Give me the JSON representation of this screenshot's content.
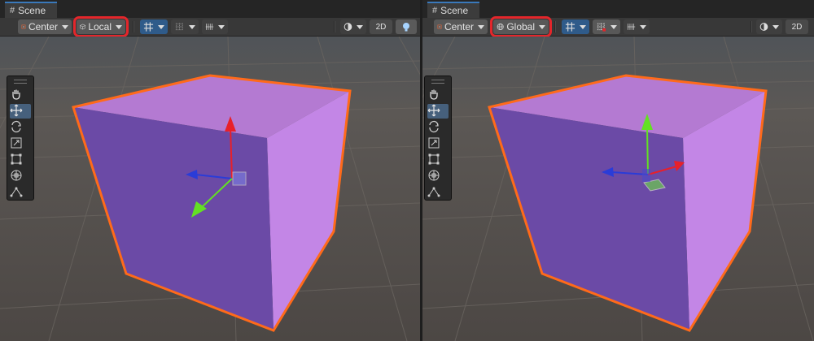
{
  "panels": [
    {
      "tab_title": "Scene",
      "pivot_label": "Center",
      "space_label": "Local",
      "mode_2d": "2D"
    },
    {
      "tab_title": "Scene",
      "pivot_label": "Center",
      "space_label": "Global",
      "mode_2d": "2D"
    }
  ],
  "colors": {
    "highlight": "#e3262b",
    "cube_front": "#6a4aa8",
    "cube_top": "#b87ad6",
    "cube_side": "#c386e6",
    "outline": "#ff6a1a",
    "axis_x": "#e8202a",
    "axis_y": "#63e023",
    "axis_z": "#2a3cd8"
  },
  "tools": [
    "hand-icon",
    "move-icon",
    "rotate-icon",
    "scale-icon",
    "rect-icon",
    "transform-icon",
    "custom-tool-icon"
  ]
}
